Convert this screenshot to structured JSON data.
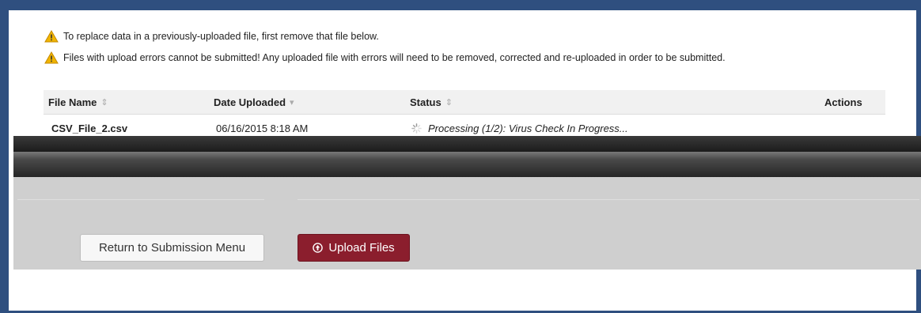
{
  "notices": [
    {
      "icon": "warning-icon",
      "text": "To replace data in a previously-uploaded file, first remove that file below."
    },
    {
      "icon": "warning-icon",
      "text": "Files with upload errors cannot be submitted! Any uploaded file with errors will need to be removed, corrected and re-uploaded in order to be submitted."
    }
  ],
  "table": {
    "columns": {
      "file_name": "File Name",
      "date_uploaded": "Date Uploaded",
      "status": "Status",
      "actions": "Actions"
    },
    "rows": [
      {
        "file_name": "CSV_File_2.csv",
        "date_uploaded": "06/16/2015 8:18 AM",
        "status": "Processing (1/2): Virus Check In Progress..."
      }
    ]
  },
  "buttons": {
    "return_label": "Return to Submission Menu",
    "upload_label": "Upload Files"
  },
  "colors": {
    "frame": "#2f4f7f",
    "upload_button": "#8b1e2d",
    "warning": "#f0b400"
  }
}
